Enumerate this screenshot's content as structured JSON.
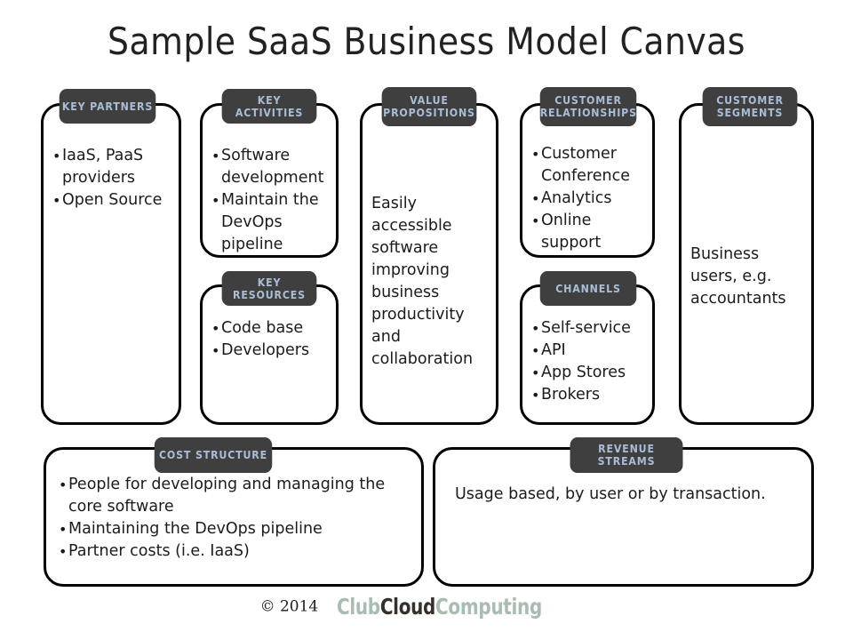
{
  "title": "Sample SaaS Business Model Canvas",
  "theme": {
    "badge_bg": "#3f3f3f",
    "badge_text": "#aabdd6",
    "card_border": "#000000",
    "page_bg": "#ffffff",
    "body_text": "#1b1b1b"
  },
  "blocks": {
    "key_partners": {
      "label": "KEY PARTNERS",
      "label_line2": "",
      "items": [
        "IaaS, PaaS providers",
        "Open Source"
      ]
    },
    "key_activities": {
      "label": "KEY ACTIVITIES",
      "label_line2": "",
      "items": [
        "Software development",
        "Maintain the DevOps pipeline"
      ]
    },
    "key_resources": {
      "label": "KEY RESOURCES",
      "label_line2": "",
      "items": [
        "Code base",
        "Developers"
      ]
    },
    "value_propositions": {
      "label": "VALUE",
      "label_line2": "PROPOSITIONS",
      "text": "Easily accessible software improving business productivity and collaboration"
    },
    "customer_relationships": {
      "label": "CUSTOMER",
      "label_line2": "RELATIONSHIPS",
      "items": [
        "Customer Conference",
        "Analytics",
        "Online support"
      ]
    },
    "channels": {
      "label": "CHANNELS",
      "label_line2": "",
      "items": [
        "Self-service",
        "API",
        "App Stores",
        "Brokers"
      ]
    },
    "customer_segments": {
      "label": "CUSTOMER",
      "label_line2": "SEGMENTS",
      "text": "Business users, e.g. accountants"
    },
    "cost_structure": {
      "label": "COST STRUCTURE",
      "label_line2": "",
      "items": [
        "People for developing and managing the core software",
        "Maintaining the DevOps pipeline",
        "Partner costs (i.e. IaaS)"
      ]
    },
    "revenue_streams": {
      "label": "REVENUE STREAMS",
      "label_line2": "",
      "text": "Usage based, by user or by transaction."
    }
  },
  "footer": {
    "copyright": "© 2014",
    "brand_part1": "Club",
    "brand_part2": "Cloud",
    "brand_part3": "Computing"
  }
}
